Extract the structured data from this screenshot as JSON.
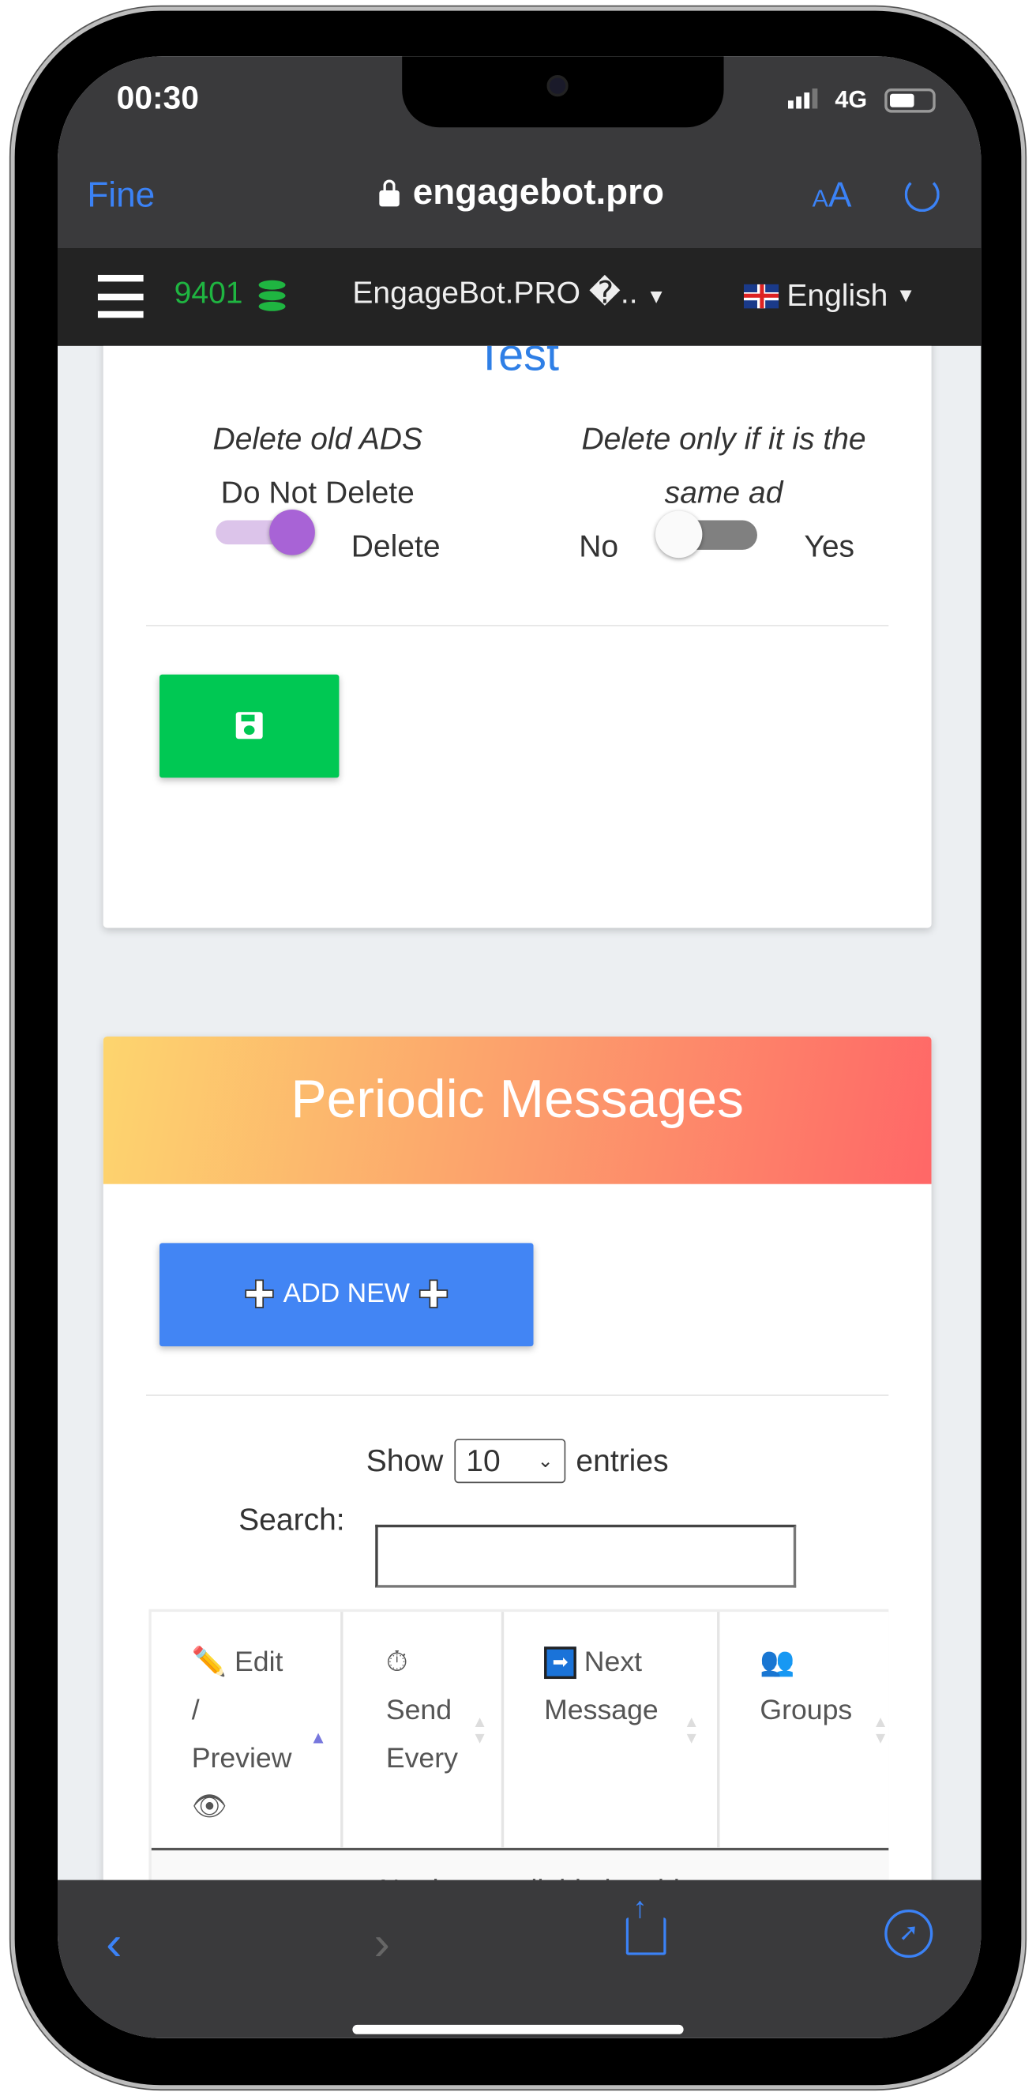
{
  "status_bar": {
    "time": "00:30",
    "network": "4G"
  },
  "browser": {
    "done_label": "Fine",
    "url": "engagebot.pro",
    "text_size_label": "AA"
  },
  "navbar": {
    "credits": "9401",
    "account": "EngageBot.PRO �..",
    "language": "English"
  },
  "settings_card": {
    "title": "Test",
    "delete_old_ads": {
      "label": "Delete old ADS",
      "off_label": "Do Not Delete",
      "on_label": "Delete",
      "enabled": true
    },
    "delete_same_ad": {
      "label_line1": "Delete only if it is the",
      "label_line2": "same ad",
      "off_label": "No",
      "on_label": "Yes",
      "enabled": false
    }
  },
  "periodic": {
    "title": "Periodic Messages",
    "add_new_label": "ADD NEW",
    "show_label": "Show",
    "entries_label": "entries",
    "page_size": "10",
    "search_label": "Search:",
    "search_value": "",
    "columns": [
      {
        "icon": "pencil-icon",
        "lines": [
          "Edit",
          "/",
          "Preview"
        ],
        "icon2": "eye-icon",
        "sorted": "asc"
      },
      {
        "icon": "stopwatch-icon",
        "lines": [
          "Send",
          "Every"
        ]
      },
      {
        "icon": "arrow-right-icon",
        "lines": [
          "Next",
          "Message"
        ]
      },
      {
        "icon": "groups-icon",
        "lines": [
          "Groups"
        ]
      }
    ],
    "empty_text": "No data available in table"
  },
  "colors": {
    "accent": "#3b82f6",
    "save": "#00c853",
    "add": "#4285f4",
    "toggle_on": "#a863d6",
    "gradient_start": "#fdd56e",
    "gradient_end": "#ff6767",
    "credits": "#1fb541"
  }
}
